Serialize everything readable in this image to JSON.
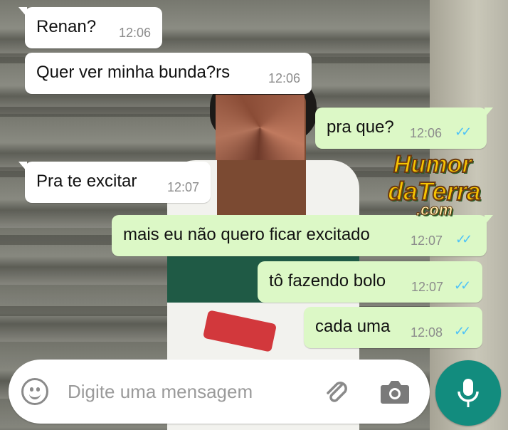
{
  "messages": [
    {
      "dir": "in",
      "text": "Renan?",
      "time": "12:06"
    },
    {
      "dir": "in",
      "text": "Quer ver minha bunda?rs",
      "time": "12:06"
    },
    {
      "dir": "out",
      "text": "pra que?",
      "time": "12:06",
      "status": "read"
    },
    {
      "dir": "in",
      "text": "Pra te excitar",
      "time": "12:07"
    },
    {
      "dir": "out",
      "text": "mais eu não quero ficar excitado",
      "time": "12:07",
      "status": "read"
    },
    {
      "dir": "out",
      "text": "tô fazendo bolo",
      "time": "12:07",
      "status": "read"
    },
    {
      "dir": "out",
      "text": "cada uma",
      "time": "12:08",
      "status": "read"
    }
  ],
  "watermark": {
    "line1": "Humor",
    "line2": "daTerra",
    "line3": ".com"
  },
  "composer": {
    "placeholder": "Digite uma mensagem",
    "icons": [
      "emoji-icon",
      "attach-icon",
      "camera-icon",
      "microphone-icon"
    ]
  },
  "colors": {
    "incoming": "#ffffff",
    "outgoing": "#dcf8c6",
    "read_ticks": "#4fc3f7",
    "mic_button": "#128c7e"
  }
}
